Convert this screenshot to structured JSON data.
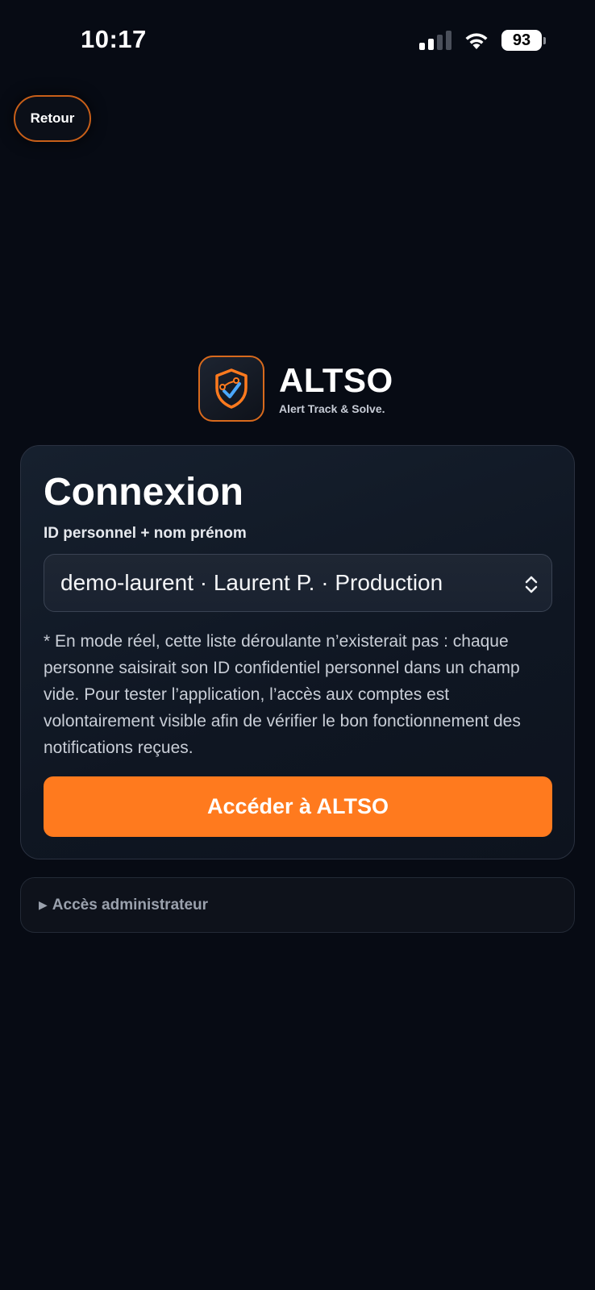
{
  "status_bar": {
    "time": "10:17",
    "battery": "93"
  },
  "nav": {
    "back_label": "Retour"
  },
  "brand": {
    "name": "ALTSO",
    "tagline": "Alert Track & Solve.",
    "logo_icon": "shield-check-icon",
    "accent_color": "#ff7a1e"
  },
  "login": {
    "title": "Connexion",
    "field_label": "ID personnel + nom prénom",
    "selected_account": "demo-laurent · Laurent P. · Production",
    "note": "* En mode réel, cette liste déroulante n’existerait pas : chaque personne saisirait son ID confidentiel personnel dans un champ vide. Pour tester l’application, l’accès aux comptes est volontairement visible afin de vérifier le bon fonctionnement des notifications reçues.",
    "submit_label": "Accéder à ALTSO"
  },
  "admin": {
    "toggle_icon": "▶",
    "label": "Accès administrateur"
  }
}
